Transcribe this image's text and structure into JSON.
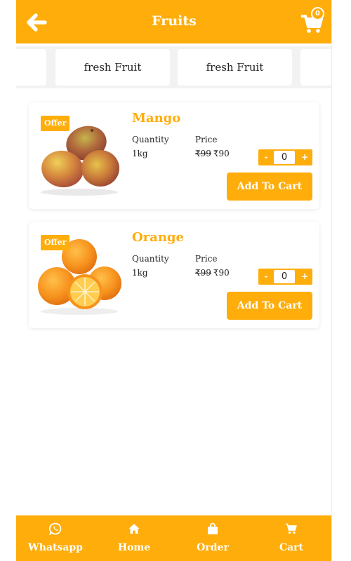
{
  "header": {
    "title": "Fruits",
    "cart_count": "0",
    "back_icon": "arrow-left-icon",
    "cart_icon": "shopping-cart-icon",
    "accent_color": "#ffad0a"
  },
  "categories": [
    {
      "label": ""
    },
    {
      "label": "fresh Fruit"
    },
    {
      "label": "fresh Fruit"
    },
    {
      "label": ""
    }
  ],
  "products": [
    {
      "name": "Mango",
      "offer": "Offer",
      "qty_label": "Quantity",
      "qty_value": "1kg",
      "price_label": "Price",
      "old_price": "₹99",
      "new_price": "₹90",
      "minus": "-",
      "count": "0",
      "plus": "+",
      "add_label": "Add To Cart"
    },
    {
      "name": "Orange",
      "offer": "Offer",
      "qty_label": "Quantity",
      "qty_value": "1kg",
      "price_label": "Price",
      "old_price": "₹99",
      "new_price": "₹90",
      "minus": "-",
      "count": "0",
      "plus": "+",
      "add_label": "Add To Cart"
    }
  ],
  "bottom_nav": [
    {
      "label": "Whatsapp",
      "icon": "whatsapp-icon"
    },
    {
      "label": "Home",
      "icon": "home-icon"
    },
    {
      "label": "Order",
      "icon": "shopping-bag-icon"
    },
    {
      "label": "Cart",
      "icon": "cart-icon"
    }
  ]
}
